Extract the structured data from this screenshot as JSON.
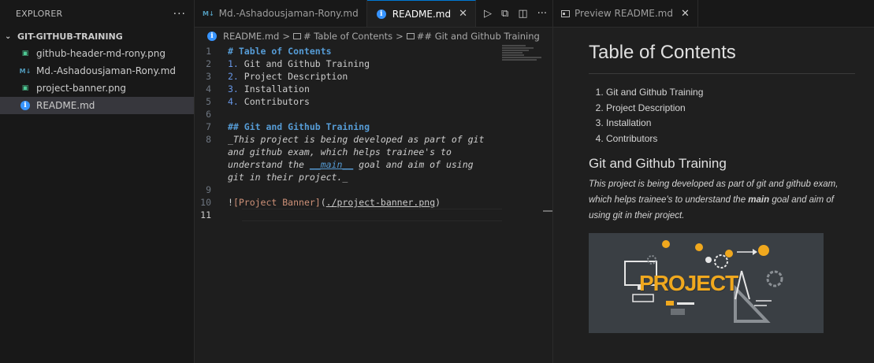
{
  "sidebar": {
    "title": "EXPLORER",
    "more": "···",
    "folder": "GIT-GITHUB-TRAINING",
    "files": [
      {
        "name": "github-header-md-rony.png",
        "icon": "image-icon",
        "glyph": "▣"
      },
      {
        "name": "Md.-Ashadousjaman-Rony.md",
        "icon": "markdown-icon",
        "glyph": "M↓"
      },
      {
        "name": "project-banner.png",
        "icon": "image-icon",
        "glyph": "▣"
      },
      {
        "name": "README.md",
        "icon": "info-icon",
        "glyph": "i"
      }
    ]
  },
  "tabs": {
    "tab1": {
      "label": "Md.-Ashadousjaman-Rony.md",
      "glyph": "M↓"
    },
    "tab2": {
      "label": "README.md",
      "glyph": "i",
      "close": "✕"
    },
    "actions": {
      "run": "▷",
      "split_preview": "⧉",
      "split": "◫",
      "more": "···"
    }
  },
  "breadcrumb": {
    "file": "README.md",
    "sep": ">",
    "item1": "# Table of Contents",
    "item2": "## Git and Github Training"
  },
  "editor": {
    "line_numbers": [
      "1",
      "2",
      "3",
      "4",
      "5",
      "6",
      "7",
      "8",
      "",
      "",
      "",
      "9",
      "10",
      "11"
    ],
    "l1": "# Table of Contents",
    "l2_num": "1.",
    "l2_text": " Git and Github Training",
    "l3_num": "2.",
    "l3_text": " Project Description",
    "l4_num": "3.",
    "l4_text": " Installation",
    "l5_num": "4.",
    "l5_text": " Contributors",
    "l7": "## Git and Github Training",
    "l8a": "_This project is being developed as part of git",
    "l8b": "and github exam, which helps trainee's to",
    "l8c_pre": "understand the ",
    "l8c_bold": "__main__",
    "l8c_post": " goal and aim of using",
    "l8d": "git in their project._",
    "l10_bang": "!",
    "l10_alt": "[Project Banner]",
    "l10_open": "(",
    "l10_url": "./project-banner.png",
    "l10_close": ")"
  },
  "preview": {
    "tab_label": "Preview README.md",
    "tab_close": "✕",
    "h1": "Table of Contents",
    "toc": [
      "Git and Github Training",
      "Project Description",
      "Installation",
      "Contributors"
    ],
    "h2": "Git and Github Training",
    "para_pre": "This project is being developed as part of git and github exam, which helps trainee's to understand the ",
    "para_bold": "main",
    "para_post": " goal and aim of using git in their project.",
    "banner_word": "PROJECT"
  },
  "colors": {
    "accent": "#0078d4",
    "heading": "#569cd6",
    "link": "#ce9178",
    "banner_bg": "#3a3f44",
    "banner_orange": "#f0a81e"
  }
}
